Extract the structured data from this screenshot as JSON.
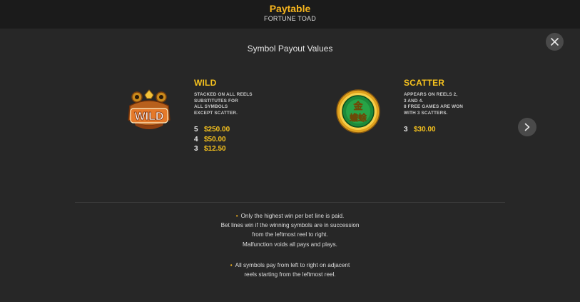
{
  "header": {
    "title": "Paytable",
    "subtitle": "FORTUNE TOAD"
  },
  "section_title": "Symbol Payout Values",
  "colors": {
    "accent_gold": "#f6c21e",
    "background": "#272727",
    "header_background": "#1b1b1b",
    "button_background": "#4a4a4a"
  },
  "icons": {
    "close": "close-icon",
    "next": "chevron-right-icon",
    "bullet": "•"
  },
  "symbols": [
    {
      "name": "WILD",
      "icon_name": "wild-toad-icon",
      "icon_text": "WILD",
      "description": [
        "STACKED ON ALL REELS",
        "SUBSTITUTES FOR",
        "ALL SYMBOLS",
        "EXCEPT SCATTER."
      ],
      "payouts": [
        {
          "count": "5",
          "amount": "$250.00"
        },
        {
          "count": "4",
          "amount": "$50.00"
        },
        {
          "count": "3",
          "amount": "$12.50"
        }
      ]
    },
    {
      "name": "SCATTER",
      "icon_name": "jade-coin-scatter-icon",
      "icon_text_top": "金",
      "icon_text_bottom": "蟾蜍",
      "description": [
        "APPEARS ON REELS 2,",
        "3 AND 4.",
        "8 FREE GAMES ARE WON",
        "WITH 3 SCATTERS."
      ],
      "payouts": [
        {
          "count": "3",
          "amount": "$30.00"
        }
      ]
    }
  ],
  "rules": [
    [
      "Only the highest win per bet line is paid.",
      "Bet lines win if the winning symbols are in succession",
      "from the leftmost reel to right.",
      "Malfunction voids all pays and plays."
    ],
    [
      "All symbols pay from left to right on adjacent",
      "reels starting from the leftmost reel."
    ]
  ]
}
